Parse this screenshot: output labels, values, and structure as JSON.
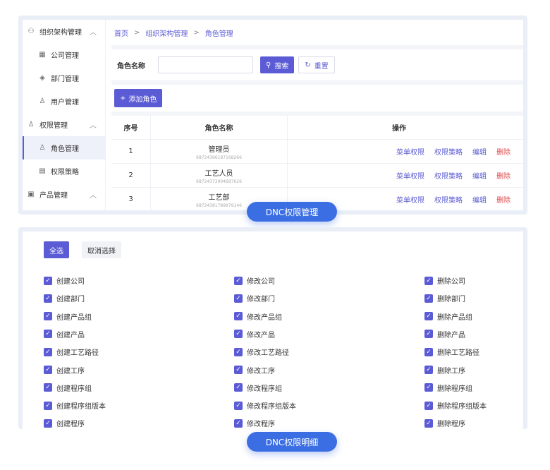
{
  "sidebar": {
    "groups": [
      {
        "label": "组织架构管理",
        "items": [
          "公司管理",
          "部门管理",
          "用户管理"
        ]
      },
      {
        "label": "权限管理",
        "items": [
          "角色管理",
          "权限策略"
        ]
      },
      {
        "label": "产品管理",
        "items": []
      }
    ],
    "active_item": "角色管理"
  },
  "breadcrumb": [
    "首页",
    "组织架构管理",
    "角色管理"
  ],
  "search": {
    "label": "角色名称",
    "value": "",
    "search_btn": "搜索",
    "reset_btn": "重置"
  },
  "add_btn": "添加角色",
  "table": {
    "headers": [
      "序号",
      "角色名称",
      "操作"
    ],
    "rows": [
      {
        "idx": "1",
        "name": "管理员",
        "id": "68724366187168266"
      },
      {
        "idx": "2",
        "name": "工艺人员",
        "id": "68724373904687626"
      },
      {
        "idx": "3",
        "name": "工艺部",
        "id": "68724381789979146"
      }
    ],
    "ops": [
      "菜单权限",
      "权限策略",
      "编辑",
      "删除"
    ]
  },
  "captions": {
    "top": "DNC权限管理",
    "bottom": "DNC权限明细"
  },
  "perm_panel": {
    "select_all": "全选",
    "cancel_select": "取消选择",
    "columns": [
      [
        "创建公司",
        "创建部门",
        "创建产品组",
        "创建产品",
        "创建工艺路径",
        "创建工序",
        "创建程序组",
        "创建程序组版本",
        "创建程序"
      ],
      [
        "修改公司",
        "修改部门",
        "修改产品组",
        "修改产品",
        "修改工艺路径",
        "修改工序",
        "修改程序组",
        "修改程序组版本",
        "修改程序"
      ],
      [
        "删除公司",
        "删除部门",
        "删除产品组",
        "删除产品",
        "删除工艺路径",
        "删除工序",
        "删除程序组",
        "删除程序组版本",
        "删除程序"
      ]
    ]
  },
  "colors": {
    "accent": "#5b5bd6",
    "caption_bg": "#3b6ee3",
    "danger": "#e54b4b",
    "panel_bg": "#e9eef7"
  }
}
